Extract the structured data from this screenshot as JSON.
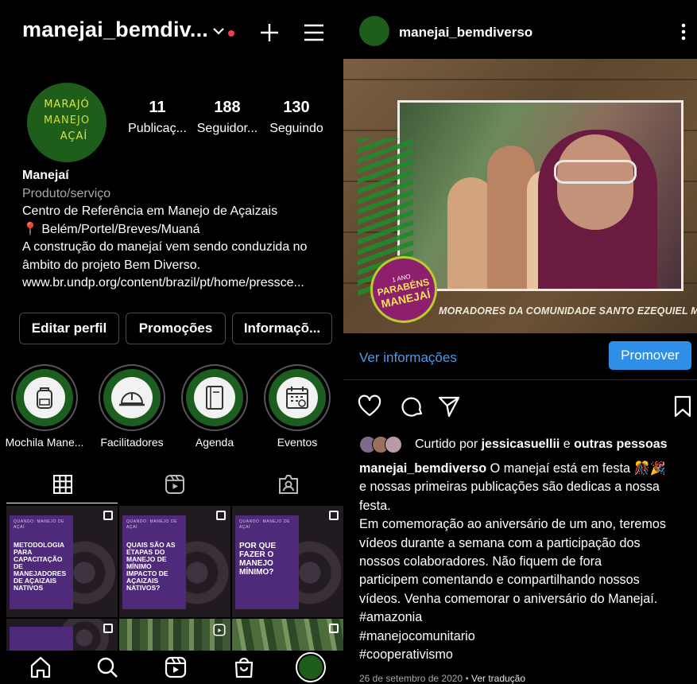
{
  "left": {
    "username": "manejai_bemdiv...",
    "avatar_text": [
      "MARAJÓ",
      "MANEJO",
      "AÇAÍ"
    ],
    "stats": [
      {
        "num": "11",
        "label": "Publicaç..."
      },
      {
        "num": "188",
        "label": "Seguidor..."
      },
      {
        "num": "130",
        "label": "Seguindo"
      }
    ],
    "bio": {
      "name": "Manejaí",
      "category": "Produto/serviço",
      "lines": [
        "Centro de Referência em Manejo de Açaizais",
        "📍 Belém/Portel/Breves/Muaná",
        "A construção do manejaí vem sendo conduzida no",
        "âmbito do projeto Bem Diverso.",
        "www.br.undp.org/content/brazil/pt/home/pressce..."
      ]
    },
    "buttons": {
      "edit": "Editar perfil",
      "promo": "Promoções",
      "info": "Informaçõ..."
    },
    "highlights": [
      "Mochila Mane...",
      "Facilitadores",
      "Agenda",
      "Eventos"
    ],
    "posts": [
      {
        "kicker": "QUANDO: MANEJO DE AÇAÍ",
        "title": "METODOLOGIA PARA CAPACITAÇÃO DE MANEJADORES DE AÇAIZAIS NATIVOS"
      },
      {
        "kicker": "QUANDO: MANEJO DE AÇAÍ",
        "title": "QUAIS SÃO AS ETAPAS DO MANEJO DE MÍNIMO IMPACTO DE AÇAIZAIS NATIVOS?"
      },
      {
        "kicker": "QUANDO: MANEJO DE AÇAÍ",
        "title": "POR QUE FAZER O MANEJO MÍNIMO?"
      }
    ]
  },
  "right": {
    "username": "manejai_bemdiverso",
    "video": {
      "caption": "MORADORES DA COMUNIDADE SANTO EZEQUIEL MORENO",
      "badge": [
        "1 ANO",
        "PARABÉNS",
        "MANEJAÍ"
      ]
    },
    "view_info": "Ver informações",
    "promote": "Promover",
    "liked_prefix": "Curtido por ",
    "liked_user": "jessicasuellii",
    "liked_mid": " e ",
    "liked_others": "outras pessoas",
    "caption_user": "manejai_bemdiverso",
    "caption_first": " O manejaí está em festa 🎊🎉",
    "caption_lines": [
      "e nossas primeiras publicações são dedicas a nossa",
      "festa.",
      "Em comemoração ao aniversário de um ano, teremos",
      "vídeos durante a semana com a participação dos",
      "nossos colaboradores. Não fiquem de fora",
      "participem comentando e compartilhando nossos",
      "vídeos. Venha comemorar o aniversário do Manejaí.",
      "#amazonia",
      "#manejocomunitario",
      "#cooperativismo"
    ],
    "date": "26 de setembro de 2020",
    "date_sep": " • ",
    "translate": "Ver tradução"
  }
}
